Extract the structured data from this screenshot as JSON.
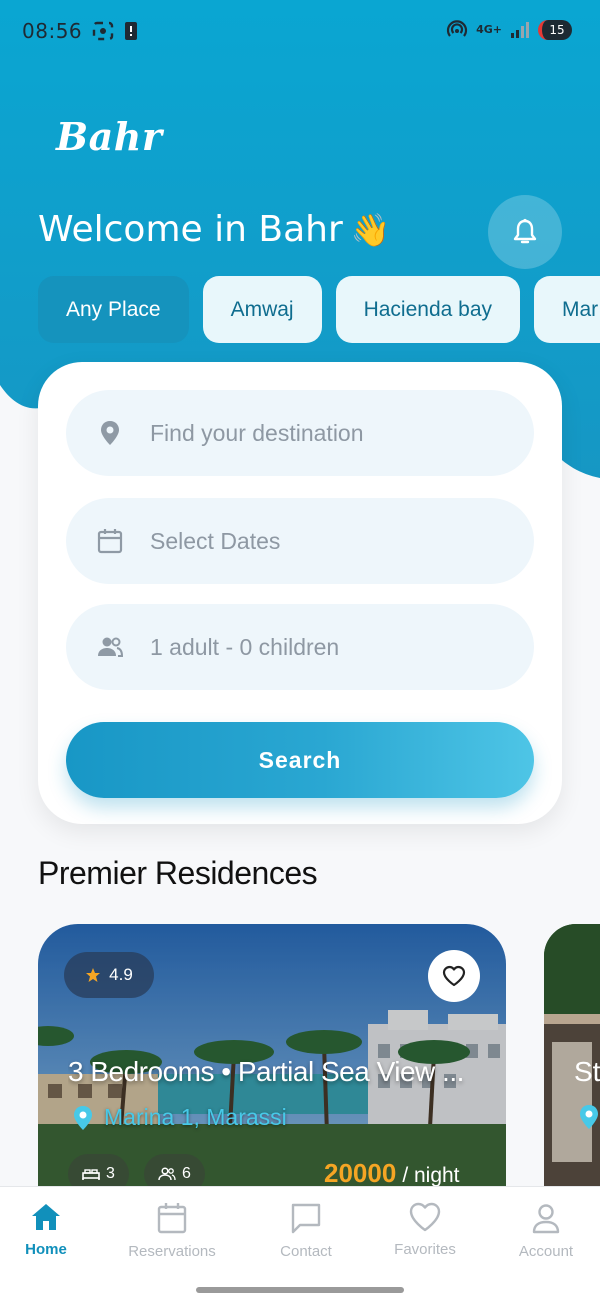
{
  "status_bar": {
    "time": "08:56",
    "network": "4G+",
    "battery": "15"
  },
  "header": {
    "logo": "Bahr",
    "welcome": "Welcome in Bahr",
    "wave_emoji": "👋"
  },
  "chips": [
    "Any Place",
    "Amwaj",
    "Hacienda bay",
    "Mar"
  ],
  "search": {
    "destination_placeholder": "Find your destination",
    "dates_placeholder": "Select Dates",
    "guests_value": "1 adult - 0 children",
    "button_label": "Search"
  },
  "section": {
    "title": "Premier Residences"
  },
  "card": {
    "rating": "4.9",
    "title": "3 Bedrooms • Partial Sea View ...",
    "location": "Marina 1, Marassi",
    "bedrooms": "3",
    "guests": "6",
    "price": "20000",
    "price_unit": "/ night"
  },
  "card_peek": {
    "title": "St"
  },
  "bottom_nav": {
    "home": "Home",
    "reservations": "Reservations",
    "contact": "Contact",
    "favorites": "Favorites",
    "account": "Account"
  },
  "colors": {
    "primary": "#1593bd",
    "hero_top": "#0aa3cf",
    "accent_price": "#f5a524"
  }
}
